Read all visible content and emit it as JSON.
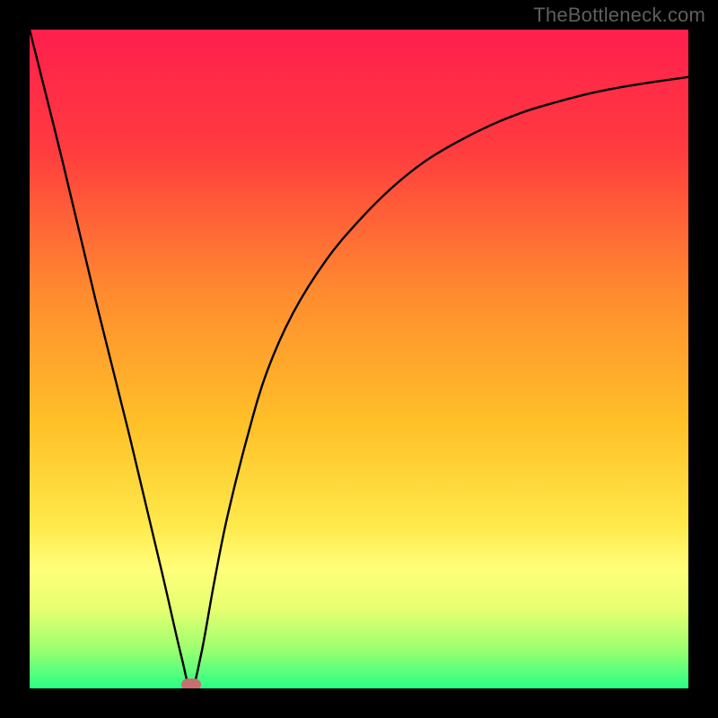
{
  "watermark": "TheBottleneck.com",
  "colors": {
    "frame": "#000000",
    "watermark": "#5f5f5f",
    "curve": "#000000",
    "marker": "#c76f6f",
    "gradient_stops": [
      {
        "pct": 0,
        "color": "#ff1f4d"
      },
      {
        "pct": 18,
        "color": "#ff3b3f"
      },
      {
        "pct": 40,
        "color": "#ff8b2f"
      },
      {
        "pct": 60,
        "color": "#ffc128"
      },
      {
        "pct": 75,
        "color": "#ffe84a"
      },
      {
        "pct": 82,
        "color": "#ffff7a"
      },
      {
        "pct": 88,
        "color": "#e5ff70"
      },
      {
        "pct": 94,
        "color": "#9cff70"
      },
      {
        "pct": 100,
        "color": "#29ff85"
      }
    ]
  },
  "chart_data": {
    "type": "line",
    "title": "",
    "xlabel": "",
    "ylabel": "",
    "xlim": [
      0,
      100
    ],
    "ylim": [
      0,
      100
    ],
    "grid": false,
    "series": [
      {
        "name": "curve",
        "x": [
          0,
          5,
          10,
          15,
          20,
          23,
          24.5,
          26,
          28,
          30,
          33,
          36,
          40,
          45,
          50,
          55,
          60,
          65,
          70,
          75,
          80,
          85,
          90,
          95,
          100
        ],
        "y": [
          100,
          80,
          59,
          39,
          18,
          5,
          0,
          5,
          16,
          26,
          38,
          48,
          57,
          65,
          71,
          76,
          80,
          83,
          85.5,
          87.5,
          89,
          90.3,
          91.3,
          92.1,
          92.8
        ]
      }
    ],
    "annotations": [
      {
        "name": "minimum-marker",
        "x": 24.5,
        "y": 0
      }
    ]
  }
}
